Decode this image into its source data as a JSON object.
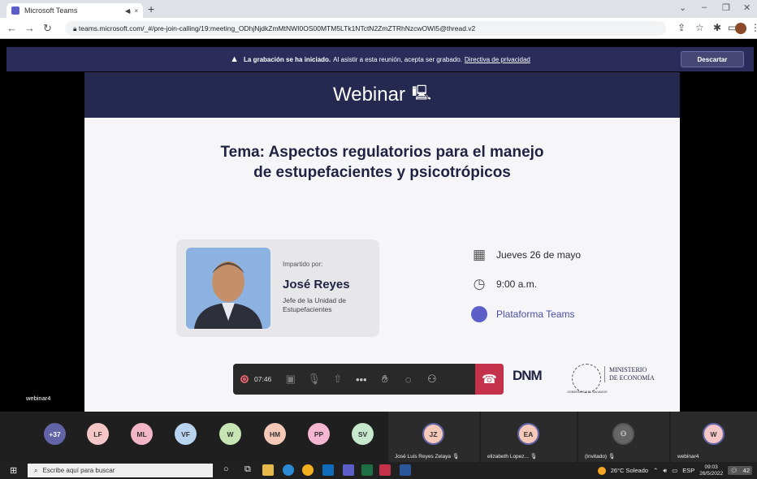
{
  "browser": {
    "tab_title": "Microsoft Teams",
    "tab_mute": "◀ᵢ",
    "tab_close": "×",
    "new_tab": "+",
    "url": "teams.microsoft.com/_#/pre-join-calling/19:meeting_ODhjNjdkZmMtNWI0OS00MTM5LTk1NTctN2ZmZTRhNzcwOWI5@thread.v2"
  },
  "banner": {
    "bold": "La grabación se ha iniciado.",
    "text": "Al asistir a esta reunión, acepta ser grabado.",
    "link": "Directiva de privacidad",
    "dismiss": "Descartar"
  },
  "slide": {
    "header": "Webinar",
    "topic_line1": "Tema: Aspectos regulatorios para el manejo",
    "topic_line2": "de estupefacientes y psicotrópicos",
    "speaker_by": "Impartido por:",
    "speaker_name": "José Reyes",
    "speaker_role": "Jefe de la Unidad de Estupefacientes",
    "date": "Jueves 26 de mayo",
    "time": "9:00 a.m.",
    "platform": "Plataforma Teams",
    "logo_dnm": "DNM",
    "gov_text": "GOBIERNO DE EL SALVADOR",
    "ministry": [
      "MINISTERIO",
      "DE ECONOMÍA"
    ]
  },
  "call": {
    "timer": "07:46",
    "self_label": "webinar4"
  },
  "participants": {
    "more": "+37",
    "avatars": [
      "LF",
      "ML",
      "VF",
      "W",
      "HM",
      "PP",
      "SV"
    ],
    "colors": [
      "#c4314b",
      "#f4c6c6",
      "#f2b6c8",
      "#b9d4f0",
      "#c7e5b4",
      "#f5c8b8",
      "#f4b6d0",
      "#c6e8cd"
    ],
    "tiles": [
      {
        "initials": "JZ",
        "name": "José Luis Reyes Zelaya"
      },
      {
        "initials": "EA",
        "name": "elizabeth Lopez..."
      },
      {
        "initials": "",
        "name": "(Invitado)"
      },
      {
        "initials": "W",
        "name": "webinar4"
      }
    ]
  },
  "taskbar": {
    "search": "Escribe aquí para buscar",
    "weather": "26°C  Soleado",
    "lang": "ESP",
    "time": "09:03",
    "date": "26/5/2022",
    "notif": "42"
  }
}
